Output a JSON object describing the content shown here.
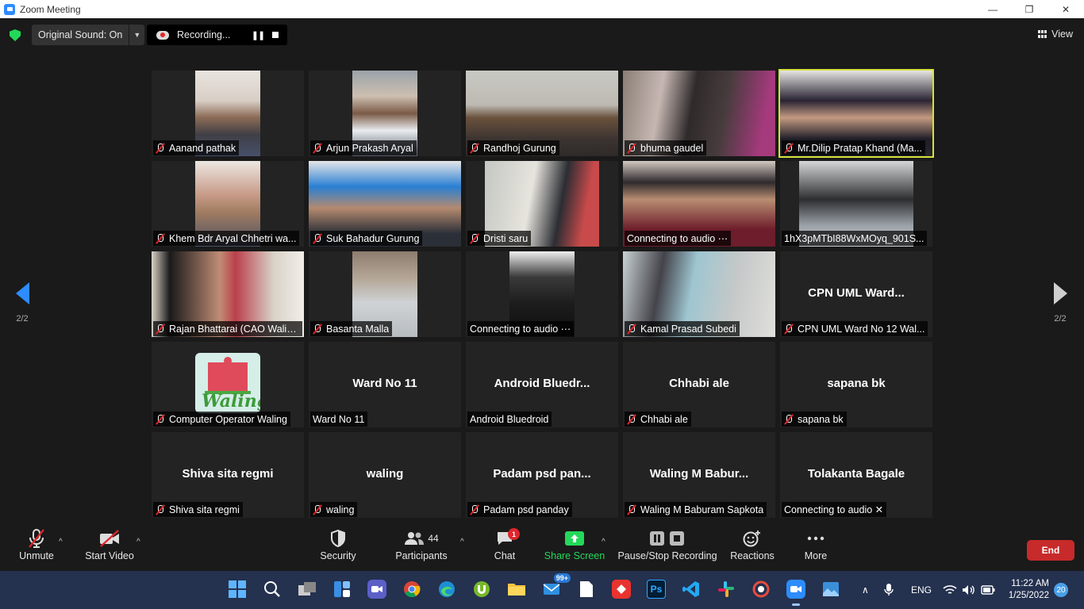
{
  "window": {
    "title": "Zoom Meeting",
    "minimize": "—",
    "restore": "❐",
    "close": "✕"
  },
  "topbar": {
    "original_sound": "Original Sound: On",
    "recording": "Recording...",
    "view": "View"
  },
  "pager": {
    "left_page": "2/2",
    "right_page": "2/2",
    "accent": "#2d8cff"
  },
  "participants": [
    {
      "name": "Aanand pathak",
      "muted": true,
      "video": true
    },
    {
      "name": "Arjun Prakash Aryal",
      "muted": true,
      "video": true
    },
    {
      "name": "Randhoj Gurung",
      "muted": true,
      "video": true
    },
    {
      "name": "bhuma gaudel",
      "muted": true,
      "video": true
    },
    {
      "name": "Mr.Dilip Pratap Khand (Ma...",
      "muted": true,
      "video": true,
      "active_speaker": true
    },
    {
      "name": "Khem Bdr Aryal Chhetri wa...",
      "muted": true,
      "video": true
    },
    {
      "name": "Suk Bahadur Gurung",
      "muted": true,
      "video": true
    },
    {
      "name": "Dristi saru",
      "muted": true,
      "video": true
    },
    {
      "name": "Connecting to audio ⋯",
      "muted": false,
      "video": true
    },
    {
      "name": "1hX3pMTbI88WxMOyq_901S...",
      "muted": false,
      "video": true
    },
    {
      "name": "Rajan Bhattarai (CAO Walin...",
      "muted": true,
      "video": true
    },
    {
      "name": "Basanta Malla",
      "muted": true,
      "video": true
    },
    {
      "name": "Connecting to audio ⋯",
      "muted": false,
      "video": true
    },
    {
      "name": "Kamal Prasad Subedi",
      "muted": true,
      "video": true
    },
    {
      "name": "CPN UML Ward No 12 Wal...",
      "display": "CPN  UML  Ward...",
      "muted": true,
      "video": false
    },
    {
      "name": "Computer Operator Waling",
      "muted": true,
      "video": true,
      "logo_text": "Waling"
    },
    {
      "name": "Ward No 11",
      "display": "Ward No 11",
      "muted": false,
      "video": false
    },
    {
      "name": "Android Bluedroid",
      "display": "Android  Bluedr...",
      "muted": false,
      "video": false
    },
    {
      "name": "Chhabi ale",
      "display": "Chhabi ale",
      "muted": true,
      "video": false
    },
    {
      "name": "sapana bk",
      "display": "sapana bk",
      "muted": true,
      "video": false
    },
    {
      "name": "Shiva sita regmi",
      "display": "Shiva sita regmi",
      "muted": true,
      "video": false
    },
    {
      "name": "waling",
      "display": "waling",
      "muted": true,
      "video": false
    },
    {
      "name": "Padam psd panday",
      "display": "Padam  psd  pan...",
      "muted": true,
      "video": false
    },
    {
      "name": "Waling M Baburam Sapkota",
      "display": "Waling  M  Babur...",
      "muted": true,
      "video": false
    },
    {
      "name": "Connecting to audio ✕",
      "display": "Tolakanta Bagale",
      "muted": false,
      "video": false
    }
  ],
  "toolbar": {
    "unmute": "Unmute",
    "start_video": "Start Video",
    "security": "Security",
    "participants": "Participants",
    "participant_count": "44",
    "chat": "Chat",
    "chat_badge": "1",
    "share_screen": "Share Screen",
    "pause_recording": "Pause/Stop Recording",
    "reactions": "Reactions",
    "more": "More",
    "end": "End"
  },
  "taskbar": {
    "mail_badge": "99+",
    "language": "ENG",
    "time": "11:22 AM",
    "date": "1/25/2022",
    "notifications": "20",
    "photoshop": "Ps"
  }
}
